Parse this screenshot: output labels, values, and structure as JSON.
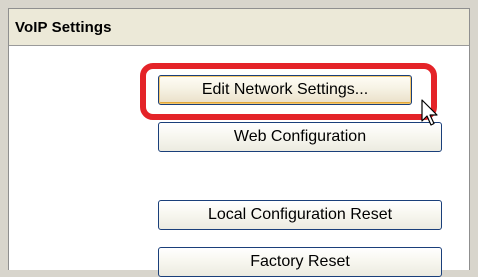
{
  "panel": {
    "title": "VoIP Settings"
  },
  "buttons": {
    "edit_network": "Edit Network Settings...",
    "web_configuration": "Web Configuration",
    "local_reset": "Local Configuration Reset",
    "factory_reset": "Factory Reset"
  },
  "colors": {
    "highlight": "#e42328",
    "button_border": "#1a3f7a",
    "header_background": "#ece9d8"
  },
  "icons": {
    "pointer": "mouse-pointer-icon"
  }
}
